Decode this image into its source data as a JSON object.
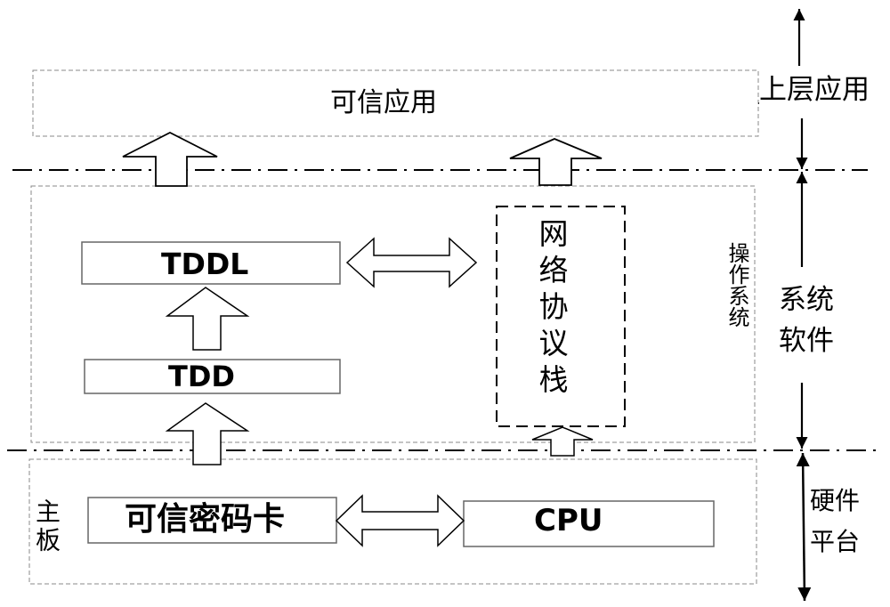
{
  "layers": {
    "upper": {
      "side_label": "上层应用",
      "box_label": "可信应用"
    },
    "system": {
      "side_label_line1": "系统",
      "side_label_line2": "软件",
      "os_label": "操作系统",
      "tddl_label": "TDDL",
      "tdd_label": "TDD",
      "netstack_label": "网络协议栈"
    },
    "hardware": {
      "side_label_line1": "硬件",
      "side_label_line2": "平台",
      "board_label": "主板",
      "crypto_card_label": "可信密码卡",
      "cpu_label": "CPU"
    }
  },
  "colors": {
    "line": "#000000",
    "dashed_border": "#888888",
    "box_border": "#666666"
  }
}
